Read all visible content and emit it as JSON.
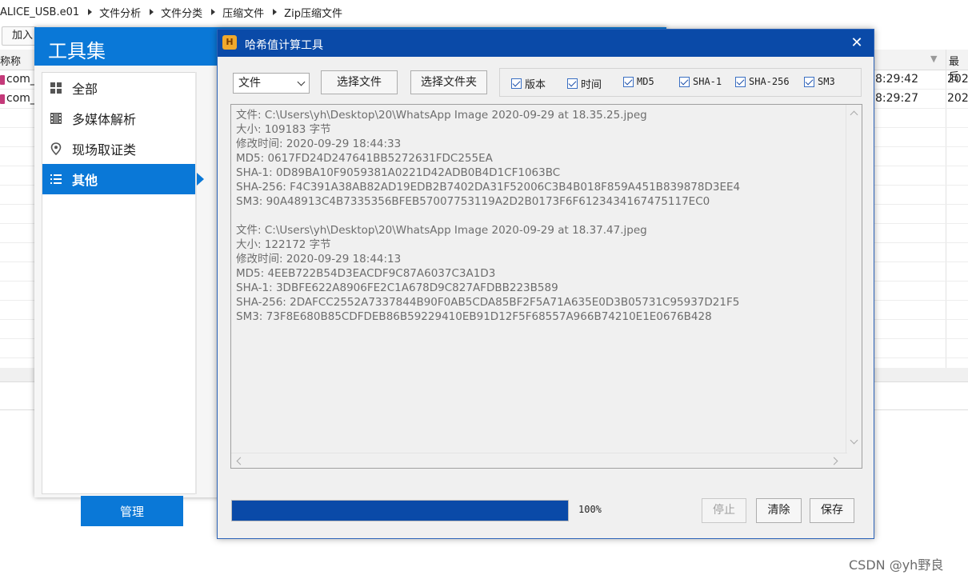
{
  "explorer": {
    "breadcrumb": [
      "ALICE_USB.e01",
      "文件分析",
      "文件分类",
      "压缩文件",
      "Zip压缩文件"
    ],
    "add_label": "加入",
    "header_name": "称称",
    "header_last": "最后",
    "rows": [
      {
        "name": "com_",
        "time": "8:29:42",
        "year": "202"
      },
      {
        "name": "com_",
        "time": "8:29:27",
        "year": "202"
      }
    ]
  },
  "toolset": {
    "title": "工具集",
    "nav": [
      {
        "label": "全部",
        "icon": "grid-icon",
        "active": false
      },
      {
        "label": "多媒体解析",
        "icon": "film-icon",
        "active": false
      },
      {
        "label": "现场取证类",
        "icon": "location-pin-icon",
        "active": false
      },
      {
        "label": "其他",
        "icon": "list-icon",
        "active": true
      }
    ],
    "manage_label": "管理",
    "accent": "#0a78d7"
  },
  "dialog": {
    "title": "哈希值计算工具",
    "app_icon_letter": "H",
    "close_glyph": "✕",
    "type_select": "文件",
    "select_file_label": "选择文件",
    "select_folder_label": "选择文件夹",
    "options": [
      {
        "label": "版本",
        "checked": true
      },
      {
        "label": "时间",
        "checked": true
      },
      {
        "label": "MD5",
        "checked": true
      },
      {
        "label": "SHA-1",
        "checked": true
      },
      {
        "label": "SHA-256",
        "checked": true
      },
      {
        "label": "SM3",
        "checked": true
      }
    ],
    "results": [
      [
        "文件: C:\\Users\\yh\\Desktop\\20\\WhatsApp Image 2020-09-29 at 18.35.25.jpeg",
        "大小: 109183 字节",
        "修改时间: 2020-09-29 18:44:33",
        "MD5: 0617FD24D247641BB5272631FDC255EA",
        "SHA-1: 0D89BA10F9059381A0221D42ADB0B4D1CF1063BC",
        "SHA-256: F4C391A38AB82AD19EDB2B7402DA31F52006C3B4B018F859A451B839878D3EE4",
        "SM3: 90A48913C4B7335356BFEB57007753119A2D2B0173F6F6123434167475117EC0"
      ],
      [
        "文件: C:\\Users\\yh\\Desktop\\20\\WhatsApp Image 2020-09-29 at 18.37.47.jpeg",
        "大小: 122172 字节",
        "修改时间: 2020-09-29 18:44:13",
        "MD5: 4EEB722B54D3EACDF9C87A6037C3A1D3",
        "SHA-1: 3DBFE622A8906FE2C1A678D9C827AFDBB223B589",
        "SHA-256: 2DAFCC2552A7337844B90F0AB5CDA85BF2F5A71A635E0D3B05731C95937D21F5",
        "SM3: 73F8E680B85CDFDEB86B59229410EB91D12F5F68557A966B74210E1E0676B428"
      ]
    ],
    "progress_percent": 100,
    "progress_text": "100%",
    "stop_label": "停止",
    "clear_label": "清除",
    "save_label": "保存",
    "accent": "#0a4aa8"
  },
  "watermark": "CSDN @yh野良"
}
